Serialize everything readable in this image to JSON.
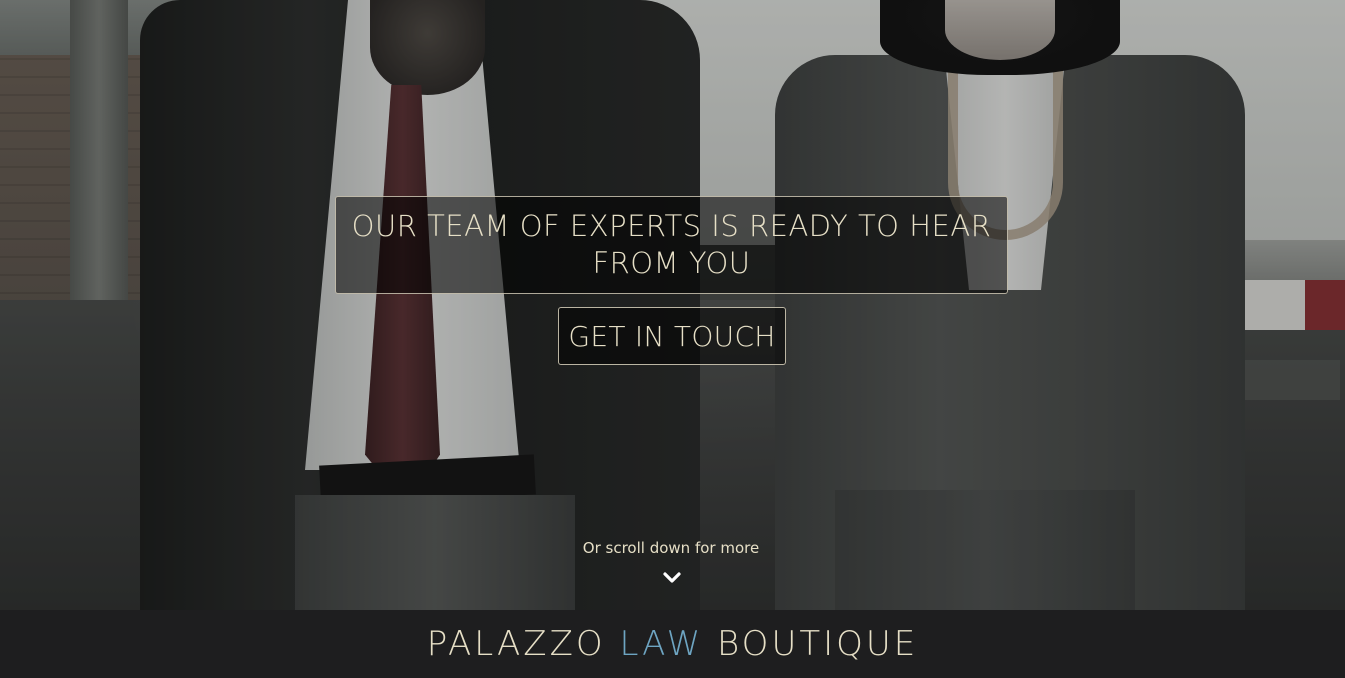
{
  "hero": {
    "headline": "OUR TEAM OF EXPERTS IS READY TO HEAR FROM YOU",
    "cta_label": "GET IN TOUCH",
    "scroll_hint": "Or scroll down for more",
    "scroll_icon": "chevron-down-icon"
  },
  "brand": {
    "part1": "PALAZZO",
    "part2": "LAW",
    "part3": "BOUTIQUE",
    "accent_color": "#6ea5c2",
    "text_color": "#e6dfc6",
    "bar_color": "#1e1e1f"
  }
}
